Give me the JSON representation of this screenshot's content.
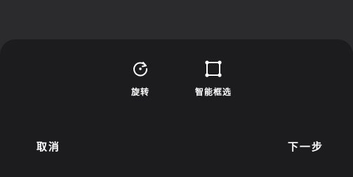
{
  "toolbar": {
    "rotate": {
      "label": "旋转",
      "icon": "rotate-icon"
    },
    "smart_select": {
      "label": "智能框选",
      "icon": "smart-select-icon"
    }
  },
  "actions": {
    "cancel_label": "取消",
    "next_label": "下一步"
  },
  "colors": {
    "background": "#2b2b2d",
    "sheet": "#1c1c1e",
    "text": "#ffffff"
  }
}
